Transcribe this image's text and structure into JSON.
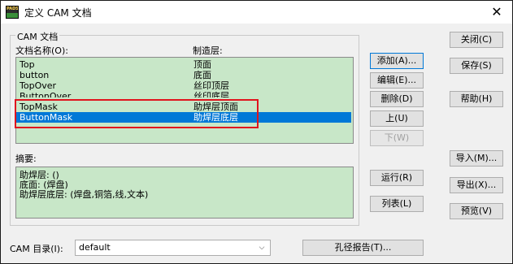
{
  "window": {
    "title": "定义 CAM 文档",
    "icon_text": "PADS",
    "close_glyph": "✕"
  },
  "group": {
    "label": "CAM 文档",
    "col_name_header": "文档名称(O):",
    "col_layer_header": "制造层:"
  },
  "documents": [
    {
      "name": "Top",
      "layer": "顶面",
      "selected": false
    },
    {
      "name": "button",
      "layer": "底面",
      "selected": false
    },
    {
      "name": "TopOver",
      "layer": "丝印顶层",
      "selected": false
    },
    {
      "name": "ButtonOver",
      "layer": "丝印底层",
      "selected": false
    },
    {
      "name": "TopMask",
      "layer": "助焊层顶面",
      "selected": false
    },
    {
      "name": "ButtonMask",
      "layer": "助焊层底层",
      "selected": true
    }
  ],
  "summary": {
    "label": "摘要:",
    "lines": [
      "助焊层: ()",
      "底面: (焊盘)",
      "助焊层底层: (焊盘,铜箔,线,文本)"
    ]
  },
  "buttons": {
    "add": "添加(A)...",
    "edit": "编辑(E)...",
    "delete": "删除(D)",
    "up": "上(U)",
    "down": "下(W)",
    "run": "运行(R)",
    "list": "列表(L)",
    "close": "关闭(C)",
    "save": "保存(S)",
    "help": "帮助(H)",
    "import": "导入(M)...",
    "export": "导出(X)...",
    "preview": "预览(V)",
    "drill_report": "孔径报告(T)..."
  },
  "cam_dir": {
    "label": "CAM 目录(I):",
    "value": "default"
  },
  "colors": {
    "list_bg": "#c8e7c8",
    "selection": "#0078d7",
    "annotation_red": "#e0141e"
  }
}
